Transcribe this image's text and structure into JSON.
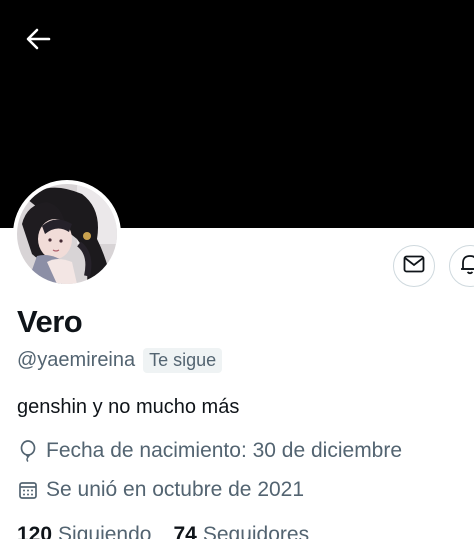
{
  "header": {
    "back_icon": "arrow-left-icon"
  },
  "profile": {
    "name": "Vero",
    "handle": "@yaemireina",
    "follows_you_badge": "Te sigue",
    "bio": "genshin y no mucho más",
    "birthday": "Fecha de nacimiento: 30 de diciembre",
    "joined": "Se unió en octubre de 2021",
    "following_count": "120",
    "following_label": "Siguiendo",
    "followers_count": "74",
    "followers_label": "Seguidores"
  },
  "actions": {
    "message_icon": "envelope-icon",
    "notify_icon": "bell-icon"
  },
  "colors": {
    "banner": "#000000",
    "text_primary": "#0f1419",
    "text_secondary": "#536471",
    "border": "#cfd9de"
  }
}
